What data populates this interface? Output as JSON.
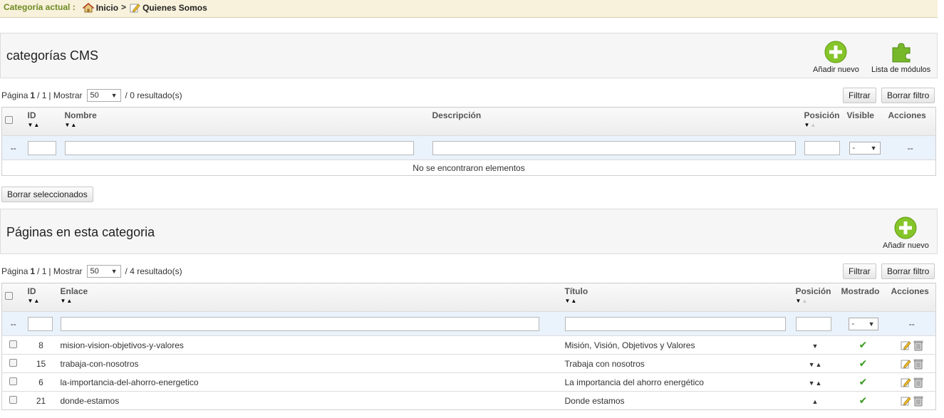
{
  "breadcrumb": {
    "label": "Categoría actual :",
    "home": "Inicio",
    "separator": ">",
    "current": "Quienes Somos"
  },
  "categories": {
    "title": "categorías CMS",
    "add_new": "Añadir nuevo",
    "modules": "Lista de módulos",
    "pagination": {
      "page_label": "Página",
      "page": "1",
      "total_pages": "/ 1",
      "show_label": "| Mostrar",
      "per_page": "50",
      "results": "/ 0 resultado(s)"
    },
    "filter_btn": "Filtrar",
    "reset_btn": "Borrar filtro",
    "columns": {
      "id": "ID",
      "name": "Nombre",
      "description": "Descripción",
      "position": "Posición",
      "visible": "Visible",
      "actions": "Acciones"
    },
    "filter_dash": "--",
    "visible_select": "-",
    "empty": "No se encontraron elementos",
    "bulk_delete": "Borrar seleccionados"
  },
  "pages": {
    "title": "Páginas en esta categoria",
    "add_new": "Añadir nuevo",
    "pagination": {
      "page_label": "Página",
      "page": "1",
      "total_pages": "/ 1",
      "show_label": "| Mostrar",
      "per_page": "50",
      "results": "/ 4 resultado(s)"
    },
    "filter_btn": "Filtrar",
    "reset_btn": "Borrar filtro",
    "columns": {
      "id": "ID",
      "link": "Enlace",
      "title": "Título",
      "position": "Posición",
      "shown": "Mostrado",
      "actions": "Acciones"
    },
    "filter_dash": "--",
    "shown_select": "-",
    "rows": [
      {
        "id": "8",
        "link": "mision-vision-objetivos-y-valores",
        "title": "Misión, Visión, Objetivos y Valores",
        "arrows": "down"
      },
      {
        "id": "15",
        "link": "trabaja-con-nosotros",
        "title": "Trabaja con nosotros",
        "arrows": "both"
      },
      {
        "id": "6",
        "link": "la-importancia-del-ahorro-energetico",
        "title": "La importancia del ahorro energético",
        "arrows": "both"
      },
      {
        "id": "21",
        "link": "donde-estamos",
        "title": "Donde estamos",
        "arrows": "up"
      }
    ]
  },
  "colors": {
    "accent_green": "#7fbf1e",
    "breadcrumb_bg": "#f8f1dc",
    "filter_row_bg": "#eaf2fb"
  }
}
